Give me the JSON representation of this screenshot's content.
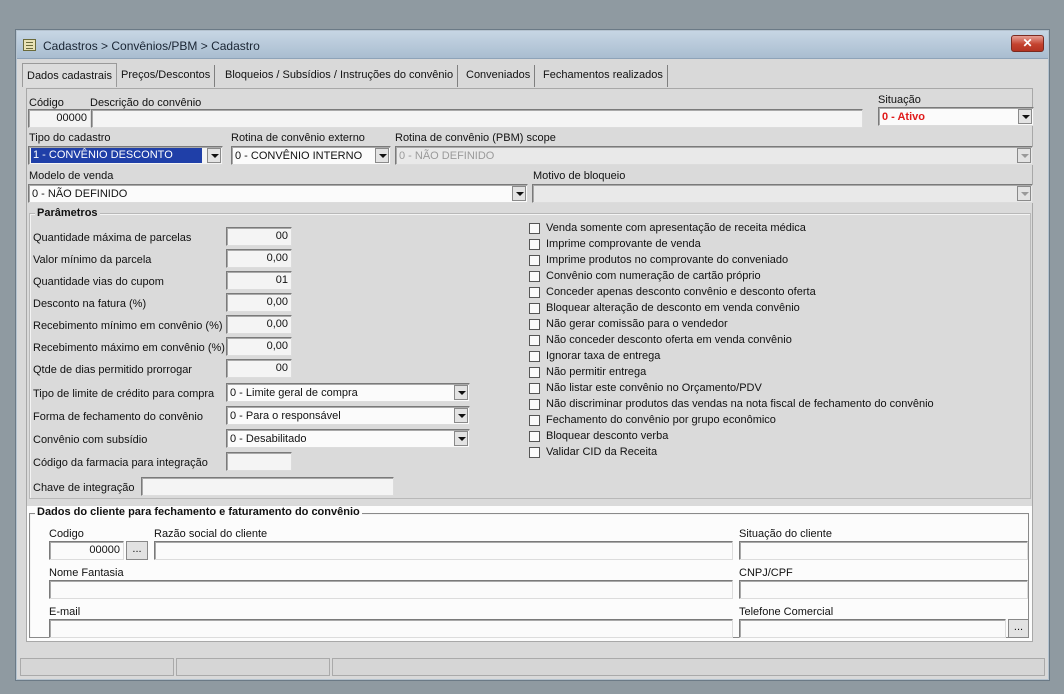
{
  "window": {
    "title": "Cadastros > Convênios/PBM > Cadastro",
    "close_label": "✕"
  },
  "tabs": [
    {
      "label": "Dados cadastrais"
    },
    {
      "label": "Preços/Descontos"
    },
    {
      "label": "Bloqueios / Subsídios / Instruções do convênio"
    },
    {
      "label": "Conveniados"
    },
    {
      "label": "Fechamentos realizados"
    }
  ],
  "header": {
    "codigo_label": "Código",
    "codigo_value": "00000",
    "descricao_label": "Descrição do convênio",
    "descricao_value": "",
    "situacao_label": "Situação",
    "situacao_value": "0 - Ativo",
    "tipo_label": "Tipo do cadastro",
    "tipo_value": "1 - CONVÊNIO DESCONTO",
    "rotina_ext_label": "Rotina de convênio externo",
    "rotina_ext_value": "0 - CONVÊNIO INTERNO",
    "rotina_pbm_label": "Rotina de convênio (PBM) scope",
    "rotina_pbm_value": "0 - NÃO DEFINIDO",
    "modelo_label": "Modelo de venda",
    "modelo_value": "0 - NÃO DEFINIDO",
    "motivo_label": "Motivo de bloqueio",
    "motivo_value": ""
  },
  "parametros": {
    "legend": "Parâmetros",
    "numeric_fields": [
      {
        "label": "Quantidade máxima de parcelas",
        "value": "00"
      },
      {
        "label": "Valor mínimo da parcela",
        "value": "0,00"
      },
      {
        "label": "Quantidade vias do cupom",
        "value": "01"
      },
      {
        "label": "Desconto na fatura (%)",
        "value": "0,00"
      },
      {
        "label": "Recebimento mínimo em convênio (%)",
        "value": "0,00"
      },
      {
        "label": "Recebimento máximo em convênio (%)",
        "value": "0,00"
      },
      {
        "label": "Qtde de dias permitido prorrogar",
        "value": "00"
      }
    ],
    "combos": [
      {
        "label": "Tipo de limite de crédito para compra",
        "value": "0 - Limite geral de compra"
      },
      {
        "label": "Forma de fechamento do convênio",
        "value": "0 - Para o responsável"
      },
      {
        "label": "Convênio com subsídio",
        "value": "0 - Desabilitado"
      }
    ],
    "codigo_farmacia_label": "Código da farmacia para integração",
    "codigo_farmacia_value": "",
    "chave_label": "Chave de integração",
    "chave_value": "",
    "checkboxes": [
      {
        "label": "Venda somente com apresentação de receita médica",
        "checked": false
      },
      {
        "label": "Imprime comprovante de venda",
        "checked": false
      },
      {
        "label": "Imprime produtos no comprovante do conveniado",
        "checked": false
      },
      {
        "label": "Convênio com numeração de cartão próprio",
        "checked": false
      },
      {
        "label": "Conceder apenas desconto convênio e desconto oferta",
        "checked": false
      },
      {
        "label": "Bloquear alteração de desconto em venda convênio",
        "checked": false
      },
      {
        "label": "Não gerar comissão para o vendedor",
        "checked": false
      },
      {
        "label": "Não conceder desconto oferta em venda convênio",
        "checked": false
      },
      {
        "label": "Ignorar taxa de entrega",
        "checked": false
      },
      {
        "label": "Não permitir entrega",
        "checked": false
      },
      {
        "label": "Não listar este convênio no Orçamento/PDV",
        "checked": false
      },
      {
        "label": "Não discriminar produtos das vendas na nota fiscal de fechamento do convênio",
        "checked": false
      },
      {
        "label": "Fechamento do convênio por grupo econômico",
        "checked": false
      },
      {
        "label": "Bloquear desconto verba",
        "checked": false
      },
      {
        "label": "Validar CID da Receita",
        "checked": false
      }
    ]
  },
  "cliente": {
    "legend": "Dados do cliente para fechamento e faturamento do convênio",
    "codigo_label": "Codigo",
    "codigo_value": "00000",
    "lookup_label": "...",
    "razao_label": "Razão social do cliente",
    "razao_value": "",
    "situacao_label": "Situação do cliente",
    "situacao_value": "",
    "fantasia_label": "Nome Fantasia",
    "fantasia_value": "",
    "cnpj_label": "CNPJ/CPF",
    "cnpj_value": "",
    "email_label": "E-mail",
    "email_value": "",
    "telefone_label": "Telefone Comercial",
    "telefone_value": "",
    "telefone_lookup_label": "..."
  },
  "colors": {
    "accent_selection": "#1f3fa8",
    "status_active": "#e01a1a",
    "close_button": "#c4422f"
  }
}
